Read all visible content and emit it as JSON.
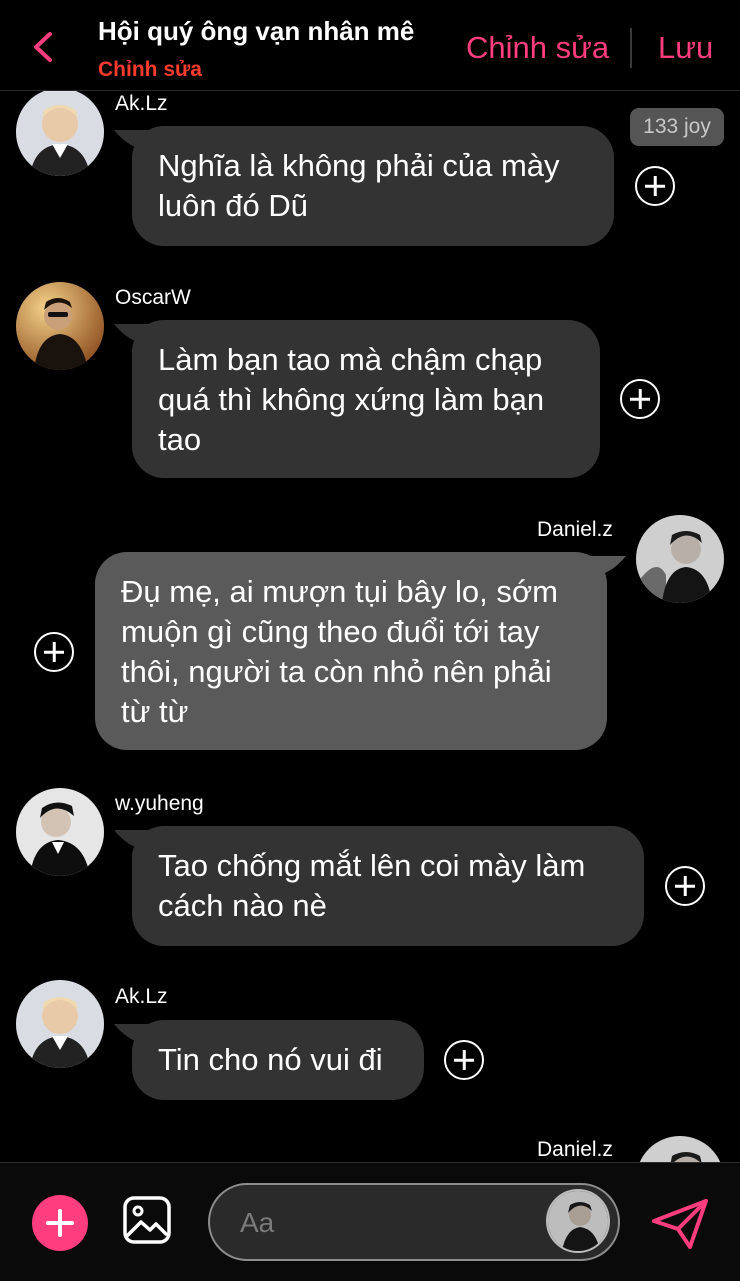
{
  "header": {
    "title": "Hội quý ông vạn nhân mê",
    "subtitle": "Chỉnh sửa",
    "edit_label": "Chỉnh sửa",
    "save_label": "Lưu"
  },
  "badge": "133 joy",
  "messages": [
    {
      "sender": "Ak.Lz",
      "text": "Nghĩa là không phải của mày luôn đó Dũ",
      "side": "left"
    },
    {
      "sender": "OscarW",
      "text": "Làm bạn tao mà chậm chạp quá thì không xứng làm bạn tao",
      "side": "left"
    },
    {
      "sender": "Daniel.z",
      "text": "Đụ mẹ, ai mượn tụi bây lo, sớm muộn gì cũng theo đuổi tới tay thôi, người ta còn nhỏ nên phải từ từ",
      "side": "right"
    },
    {
      "sender": "w.yuheng",
      "text": "Tao chống mắt lên coi mày làm cách nào nè",
      "side": "left"
    },
    {
      "sender": "Ak.Lz",
      "text": "Tin cho nó vui đi",
      "side": "left"
    },
    {
      "sender": "Daniel.z",
      "text": "",
      "side": "right"
    }
  ],
  "composer": {
    "placeholder": "Aa"
  },
  "colors": {
    "accent": "#ff3d7f",
    "subtitle": "#ff3b30",
    "bubble_left": "#333333",
    "bubble_right": "#5a5a5a"
  },
  "icons": {
    "back": "chevron-left-icon",
    "add": "plus-icon",
    "gallery": "image-icon",
    "send": "paper-plane-icon",
    "react": "plus-circle-icon"
  }
}
